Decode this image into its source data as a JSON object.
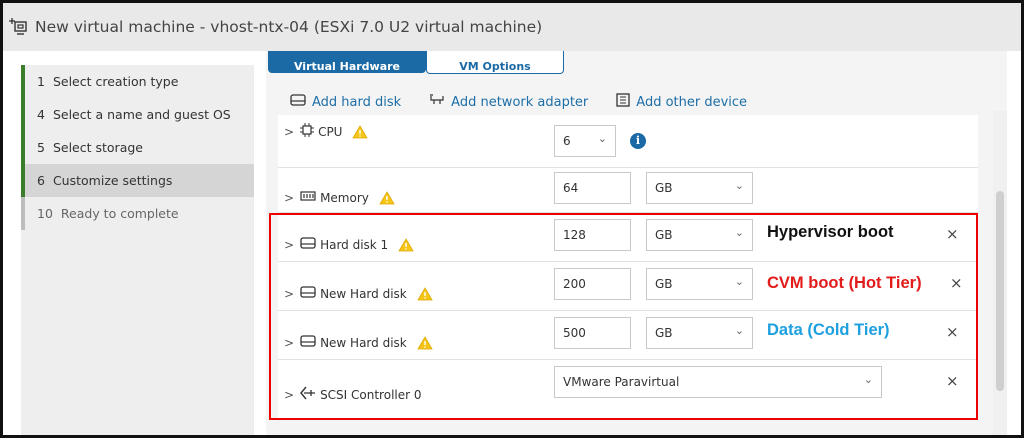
{
  "window": {
    "title": "New virtual machine - vhost-ntx-04 (ESXi 7.0 U2 virtual machine)"
  },
  "steps": [
    {
      "num": "1",
      "label": "Select creation type",
      "state": "done"
    },
    {
      "num": "4",
      "label": "Select a name and guest OS",
      "state": "done"
    },
    {
      "num": "5",
      "label": "Select storage",
      "state": "done"
    },
    {
      "num": "6",
      "label": "Customize settings",
      "state": "active"
    },
    {
      "num": "10",
      "label": "Ready to complete",
      "state": "future"
    }
  ],
  "tabs": {
    "virtual_hardware": "Virtual Hardware",
    "vm_options": "VM Options"
  },
  "toolbar": {
    "add_hard_disk": "Add hard disk",
    "add_network_adapter": "Add network adapter",
    "add_other_device": "Add other device"
  },
  "devices": {
    "cpu": {
      "label": "CPU",
      "value": "6"
    },
    "memory": {
      "label": "Memory",
      "value": "64",
      "unit": "GB"
    },
    "disk1": {
      "label": "Hard disk 1",
      "value": "128",
      "unit": "GB",
      "note": "Hypervisor boot"
    },
    "disk2": {
      "label": "New Hard disk",
      "value": "200",
      "unit": "GB",
      "note": "CVM boot (Hot Tier)"
    },
    "disk3": {
      "label": "New Hard disk",
      "value": "500",
      "unit": "GB",
      "note": "Data (Cold Tier)"
    },
    "scsi": {
      "label": "SCSI Controller 0",
      "value": "VMware Paravirtual"
    }
  },
  "colors": {
    "accent": "#1b6aa5",
    "progress_green": "#3a7d2b",
    "note_black": "#111111",
    "note_red": "#e21b1b",
    "note_blue": "#1ea0e0",
    "annotation_box": "#e00000",
    "warning": "#f5c518"
  }
}
